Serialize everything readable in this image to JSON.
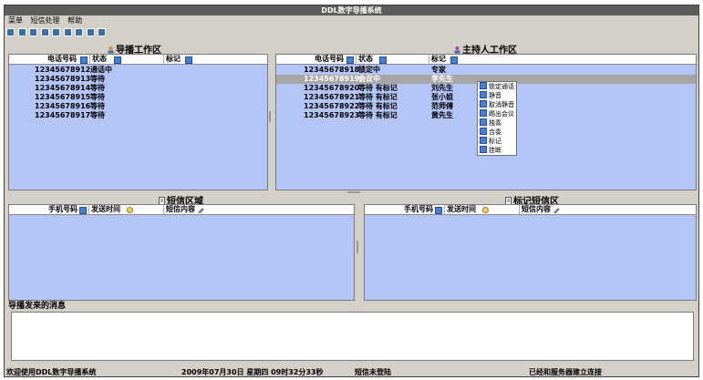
{
  "window": {
    "title": "DDL数字导播系统"
  },
  "menu": {
    "items": [
      "菜单",
      "短信处理",
      "帮助"
    ]
  },
  "toolbar": {
    "button_count": 9,
    "button_color": "#3a6ea5"
  },
  "director_panel": {
    "title": "导播工作区",
    "columns": [
      "电话号码",
      "状态",
      "标记"
    ],
    "rows": [
      {
        "phone": "12345678912",
        "status": "通话中",
        "mark": ""
      },
      {
        "phone": "12345678913",
        "status": "等待",
        "mark": ""
      },
      {
        "phone": "12345678914",
        "status": "等待",
        "mark": ""
      },
      {
        "phone": "12345678915",
        "status": "等待",
        "mark": ""
      },
      {
        "phone": "12345678916",
        "status": "等待",
        "mark": ""
      },
      {
        "phone": "12345678917",
        "status": "等待",
        "mark": ""
      }
    ]
  },
  "host_panel": {
    "title": "主持人工作区",
    "columns": [
      "电话号码",
      "状态",
      "标记"
    ],
    "rows": [
      {
        "phone": "12345678918",
        "status": "锁定中",
        "mark": "专家",
        "selected": false
      },
      {
        "phone": "12345678919",
        "status": "会议中",
        "mark": "李先生",
        "selected": true
      },
      {
        "phone": "12345678920",
        "status": "等待 有标记",
        "mark": "刘先生",
        "selected": false
      },
      {
        "phone": "12345678921",
        "status": "等待 有标记",
        "mark": "张小姐",
        "selected": false
      },
      {
        "phone": "12345678922",
        "status": "等待 有标记",
        "mark": "范师傅",
        "selected": false
      },
      {
        "phone": "12345678923",
        "status": "等待 有标记",
        "mark": "黄先生",
        "selected": false
      }
    ]
  },
  "context_menu": {
    "items": [
      "锁定通话",
      "静音",
      "取消静音",
      "踢出会议",
      "独奏",
      "合奏",
      "标记",
      "挂断"
    ]
  },
  "sms_panel": {
    "title": "短信区域",
    "columns": [
      "手机号码",
      "发送时间",
      "短信内容"
    ]
  },
  "marked_sms_panel": {
    "title": "标记短信区",
    "columns": [
      "手机号码",
      "发送时间",
      "短信内容"
    ]
  },
  "messages": {
    "title": "导播发来的消息"
  },
  "status_bar": {
    "welcome": "欢迎使用DDL数字导播系统",
    "datetime": "2009年07月30日 星期四 09时32分33秒",
    "login": "短信未登陆",
    "server": "已经和服务器建立连接"
  },
  "colors": {
    "grid_bg": "#b3c4f5",
    "selected_row": "#a6a6a6",
    "title_bar": "#5c5c5c",
    "window_bg": "#d4d0c8"
  }
}
